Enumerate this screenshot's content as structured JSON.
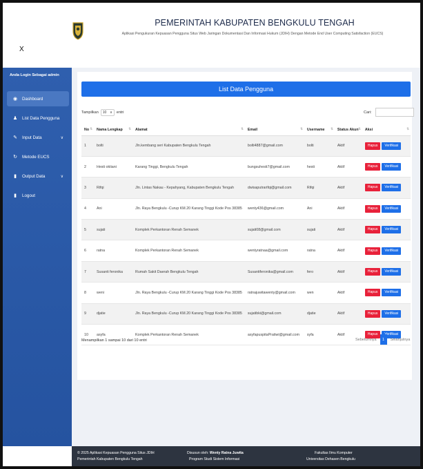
{
  "header": {
    "title": "PEMERINTAH KABUPATEN BENGKULU TENGAH",
    "subtitle": "Aplikasi Pengukuran Kepuasan Pengguna Situs Web Jaringan Dokumentasi Dan Informasi Hukum (JDIH) Dengan Metode End User Computing Satisfaction (EUCS)",
    "close_label": "X"
  },
  "sidebar": {
    "login_as": "Anda Login Sebagai admin",
    "items": [
      {
        "label": "Dashboard",
        "icon": "gauge-icon",
        "glyph": "◉"
      },
      {
        "label": "List Data Pengguna",
        "icon": "user-icon",
        "glyph": "♟"
      },
      {
        "label": "Input Data",
        "icon": "edit-icon",
        "glyph": "✎"
      },
      {
        "label": "Metode EUCS",
        "icon": "refresh-icon",
        "glyph": "↻"
      },
      {
        "label": "Output Data",
        "icon": "document-icon",
        "glyph": "▮"
      },
      {
        "label": "Logout",
        "icon": "logout-icon",
        "glyph": "▮"
      }
    ]
  },
  "card": {
    "title": "List Data Pengguna",
    "show_label": "Tampilkan",
    "show_value": "10",
    "show_suffix": "entri",
    "search_label": "Cari:",
    "columns": [
      "No",
      "Nama Lengkap",
      "Alamat",
      "Email",
      "Username",
      "Status Akun",
      "Aksi"
    ],
    "rows": [
      {
        "no": "1",
        "nama": "bolti",
        "alamat": "Jln.kembang seri Kabupaten Bengkulu Tengah",
        "email": "bolti4887@gmail.com",
        "username": "bolti",
        "status": "Aktif"
      },
      {
        "no": "2",
        "nama": "Hesti oktiani",
        "alamat": "Karang Tinggi, Bengkulu Tengah",
        "email": "bungsuhesti7@gmail.com",
        "username": "hesti",
        "status": "Aktif"
      },
      {
        "no": "3",
        "nama": "Rifqi",
        "alamat": "Jln. Lintas Nakau - Kepahyang, Kabupaten Bengkulu Tengah",
        "email": "dwisaputrarifqi@gmail.com",
        "username": "Rifqi",
        "status": "Aktif"
      },
      {
        "no": "4",
        "nama": "Ani",
        "alamat": "Jln. Raya Bengkulu -Curup KM.20 Karang Tinggi Kode Pos 38385",
        "email": "wenty436@gmail.com",
        "username": "Ani",
        "status": "Aktif"
      },
      {
        "no": "5",
        "nama": "sujati",
        "alamat": "Komplek Perkantoran Renah Semanek",
        "email": "sujati08@gmail.com",
        "username": "sujati",
        "status": "Aktif"
      },
      {
        "no": "6",
        "nama": "ratna",
        "alamat": "Komplek Perkantoran Renah Semanek",
        "email": "wentyratnaa@gmail.com",
        "username": "ratna",
        "status": "Aktif"
      },
      {
        "no": "7",
        "nama": "Susanti feronika",
        "alamat": "Rumah Sakit Daerah Bengkulu Tengah",
        "email": "Susantiferonika@gmail.com",
        "username": "fero",
        "status": "Aktif"
      },
      {
        "no": "8",
        "nama": "weni",
        "alamat": "Jln. Raya Bengkulu -Curup KM.20 Karang Tinggi Kode Pos 38385",
        "email": "ratnajuwitawenty@gmail.com",
        "username": "wen",
        "status": "Aktif"
      },
      {
        "no": "9",
        "nama": "djatie",
        "alamat": "Jln. Raya Bengkulu -Curup KM.20 Karang Tinggi Kode Pos 38385",
        "email": "sujatibki@gmail.com",
        "username": "djatie",
        "status": "Aktif"
      },
      {
        "no": "10",
        "nama": "asyfa",
        "alamat": "Komplek Perkantoran Renah Semanek",
        "email": "asyfapuspitaPratiwi@gmail.com",
        "username": "syfa",
        "status": "Aktif"
      }
    ],
    "delete_label": "Hapus",
    "verify_label": "Verifikasi",
    "info": "Menampilkan 1 sampai 10 dari 10 entri",
    "prev_label": "Sebelumnya",
    "current_page": "1",
    "next_label": "Selanjutnya"
  },
  "footer": {
    "left_1": "© 2025 Aplikasi Kepuasan Pengguna Situs JDIH",
    "left_2": "Pemerintah Kabupaten Bengkulu Tengah",
    "center_prefix": "Disusun oleh:",
    "center_name": "Wenty Ratna Juwita",
    "center_2": "Program Studi Sistem Informasi",
    "right_1": "Fakultas Ilmu Komputer",
    "right_2": "Universitas Dehasen Bengkulu"
  }
}
